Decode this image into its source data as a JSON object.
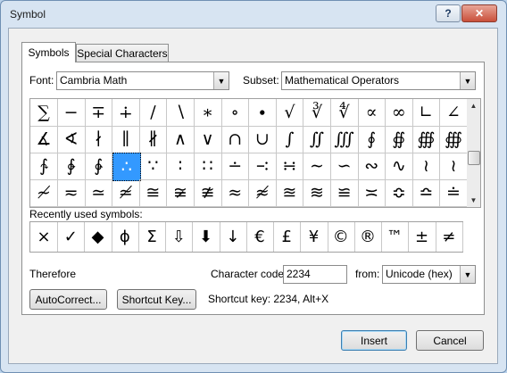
{
  "window": {
    "title": "Symbol",
    "help_label": "?",
    "close_label": "✕"
  },
  "tabs": [
    {
      "label": "Symbols",
      "active": true
    },
    {
      "label": "Special Characters",
      "active": false
    }
  ],
  "font": {
    "label": "Font:",
    "value": "Cambria Math"
  },
  "subset": {
    "label": "Subset:",
    "value": "Mathematical Operators"
  },
  "symbol_grid": {
    "rows": [
      [
        "∑",
        "−",
        "∓",
        "∔",
        "∕",
        "∖",
        "∗",
        "∘",
        "∙",
        "√",
        "∛",
        "∜",
        "∝",
        "∞",
        "∟",
        "∠"
      ],
      [
        "∡",
        "∢",
        "∤",
        "∥",
        "∦",
        "∧",
        "∨",
        "∩",
        "∪",
        "∫",
        "∬",
        "∭",
        "∮",
        "∯",
        "∰",
        "∰"
      ],
      [
        "∱",
        "∲",
        "∳",
        "∴",
        "∵",
        "∶",
        "∷",
        "∸",
        "∹",
        "∺",
        "∼",
        "∽",
        "∾",
        "∿",
        "≀",
        "≀"
      ],
      [
        "≁",
        "≂",
        "≃",
        "≄",
        "≅",
        "≆",
        "≇",
        "≈",
        "≉",
        "≊",
        "≋",
        "≌",
        "≍",
        "≎",
        "≏",
        "≐"
      ]
    ],
    "selected": {
      "row": 2,
      "col": 3
    }
  },
  "recently_used": {
    "label": "Recently used symbols:",
    "symbols": [
      "×",
      "✓",
      "◆",
      "ϕ",
      "Σ",
      "⇩",
      "⬇",
      "↓",
      "€",
      "£",
      "¥",
      "©",
      "®",
      "™",
      "±",
      "≠"
    ]
  },
  "selected_info": {
    "name": "Therefore",
    "char_code_label": "Character code:",
    "char_code_value": "2234",
    "from_label": "from:",
    "from_value": "Unicode (hex)"
  },
  "buttons": {
    "autocorrect": "AutoCorrect...",
    "shortcut_key": "Shortcut Key...",
    "insert": "Insert",
    "cancel": "Cancel"
  },
  "shortcut_text": "Shortcut key: 2234, Alt+X"
}
